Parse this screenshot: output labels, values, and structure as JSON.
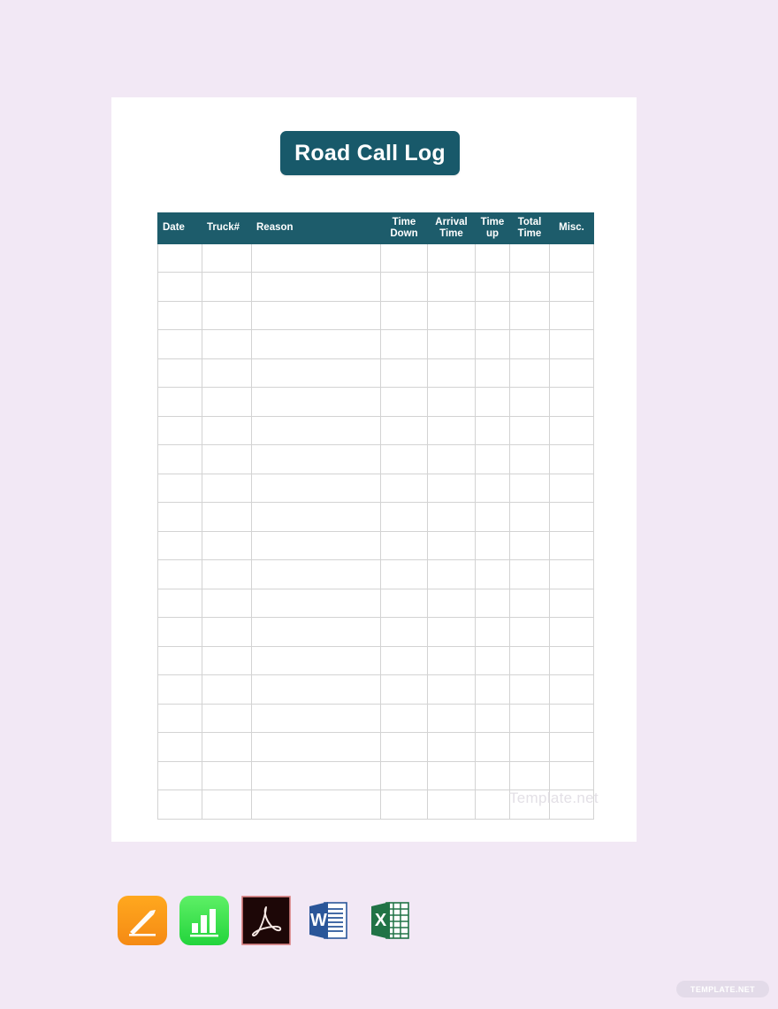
{
  "page": {
    "background_color": "#f2e8f5",
    "card_background": "#ffffff",
    "accent_color": "#1d5c6b"
  },
  "document": {
    "title": "Road Call Log",
    "watermark": "Template.net"
  },
  "table": {
    "columns": [
      {
        "label": "Date",
        "align": "left"
      },
      {
        "label": "Truck#",
        "align": "left"
      },
      {
        "label": "Reason",
        "align": "left"
      },
      {
        "label": "Time Down",
        "align": "center"
      },
      {
        "label": "Arrival Time",
        "align": "center"
      },
      {
        "label": "Time up",
        "align": "center"
      },
      {
        "label": "Total Time",
        "align": "center"
      },
      {
        "label": "Misc.",
        "align": "center"
      }
    ],
    "row_count": 20,
    "rows": [
      [
        "",
        "",
        "",
        "",
        "",
        "",
        "",
        ""
      ],
      [
        "",
        "",
        "",
        "",
        "",
        "",
        "",
        ""
      ],
      [
        "",
        "",
        "",
        "",
        "",
        "",
        "",
        ""
      ],
      [
        "",
        "",
        "",
        "",
        "",
        "",
        "",
        ""
      ],
      [
        "",
        "",
        "",
        "",
        "",
        "",
        "",
        ""
      ],
      [
        "",
        "",
        "",
        "",
        "",
        "",
        "",
        ""
      ],
      [
        "",
        "",
        "",
        "",
        "",
        "",
        "",
        ""
      ],
      [
        "",
        "",
        "",
        "",
        "",
        "",
        "",
        ""
      ],
      [
        "",
        "",
        "",
        "",
        "",
        "",
        "",
        ""
      ],
      [
        "",
        "",
        "",
        "",
        "",
        "",
        "",
        ""
      ],
      [
        "",
        "",
        "",
        "",
        "",
        "",
        "",
        ""
      ],
      [
        "",
        "",
        "",
        "",
        "",
        "",
        "",
        ""
      ],
      [
        "",
        "",
        "",
        "",
        "",
        "",
        "",
        ""
      ],
      [
        "",
        "",
        "",
        "",
        "",
        "",
        "",
        ""
      ],
      [
        "",
        "",
        "",
        "",
        "",
        "",
        "",
        ""
      ],
      [
        "",
        "",
        "",
        "",
        "",
        "",
        "",
        ""
      ],
      [
        "",
        "",
        "",
        "",
        "",
        "",
        "",
        ""
      ],
      [
        "",
        "",
        "",
        "",
        "",
        "",
        "",
        ""
      ],
      [
        "",
        "",
        "",
        "",
        "",
        "",
        "",
        ""
      ],
      [
        "",
        "",
        "",
        "",
        "",
        "",
        "",
        ""
      ]
    ]
  },
  "formats": [
    {
      "name": "apple-pages",
      "label": "Apple Pages",
      "color": "#f79a1a"
    },
    {
      "name": "apple-numbers",
      "label": "Apple Numbers",
      "color": "#3ddc4b"
    },
    {
      "name": "adobe-pdf",
      "label": "PDF",
      "color": "#1f0b0b"
    },
    {
      "name": "ms-word",
      "label": "MS Word",
      "color": "#2a5699"
    },
    {
      "name": "ms-excel",
      "label": "MS Excel",
      "color": "#217346"
    }
  ],
  "brand": {
    "pill_label": "TEMPLATE.NET"
  }
}
